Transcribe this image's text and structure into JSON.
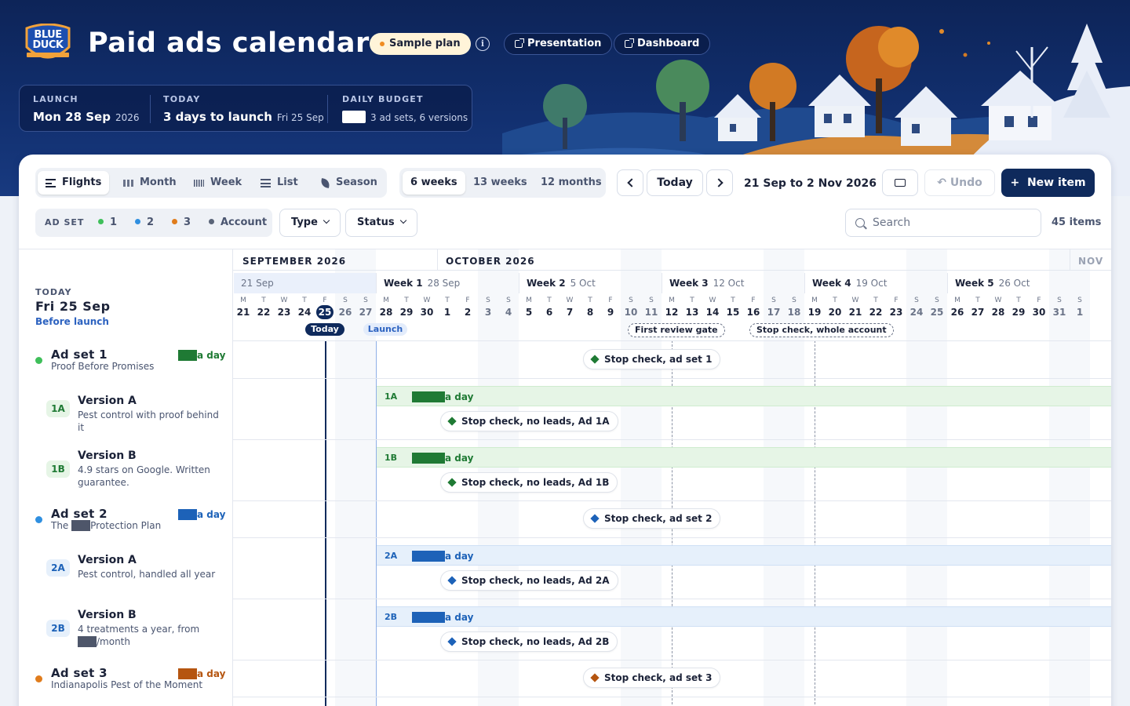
{
  "header": {
    "logo_text": "BLUE DUCK",
    "title": "Paid ads calendar",
    "sample_badge": "Sample plan",
    "info_icon": "info-icon",
    "presentation_label": "Presentation",
    "dashboard_label": "Dashboard"
  },
  "stats": {
    "launch_label": "LAUNCH",
    "launch_value": "Mon 28 Sep",
    "launch_year": "2026",
    "today_label": "TODAY",
    "today_value": "3 days to launch",
    "today_sub": "Fri 25 Sep",
    "budget_label": "DAILY BUDGET",
    "budget_sub": "3 ad sets, 6 versions"
  },
  "toolbar": {
    "views": [
      "Flights",
      "Month",
      "Week",
      "List",
      "Season"
    ],
    "active_view": "Flights",
    "ranges": [
      "6 weeks",
      "13 weeks",
      "12 months"
    ],
    "active_range": "6 weeks",
    "today_button": "Today",
    "date_range": "21 Sep to 2 Nov 2026",
    "undo_label": "Undo",
    "new_item_label": "New item"
  },
  "filters": {
    "adset_label": "AD SET",
    "set1": "1",
    "set2": "2",
    "set3": "3",
    "account": "Account",
    "type_label": "Type",
    "status_label": "Status",
    "search_placeholder": "Search",
    "item_count": "45 items"
  },
  "colors": {
    "set1": "#3fbf5a",
    "set2": "#2f8fe0",
    "set3": "#e07c1c",
    "account": "#5a6478",
    "set1_bar": "#e6f5e6",
    "set2_bar": "#e6f0fb",
    "set1_budget": "#1f7a34",
    "set2_budget": "#1d62b8",
    "set3_budget": "#b55510"
  },
  "calendar": {
    "months": [
      "SEPTEMBER 2026",
      "OCTOBER 2026",
      "NOV"
    ],
    "first_week": "21 Sep",
    "weeks": [
      {
        "name": "Week 1",
        "date": "28 Sep"
      },
      {
        "name": "Week 2",
        "date": "5 Oct"
      },
      {
        "name": "Week 3",
        "date": "12 Oct"
      },
      {
        "name": "Week 4",
        "date": "19 Oct"
      },
      {
        "name": "Week 5",
        "date": "26 Oct"
      }
    ],
    "day_letters": [
      "M",
      "T",
      "W",
      "T",
      "F",
      "S",
      "S"
    ],
    "days": [
      "21",
      "22",
      "23",
      "24",
      "25",
      "26",
      "27",
      "28",
      "29",
      "30",
      "1",
      "2",
      "3",
      "4",
      "5",
      "6",
      "7",
      "8",
      "9",
      "10",
      "11",
      "12",
      "13",
      "14",
      "15",
      "16",
      "17",
      "18",
      "19",
      "20",
      "21",
      "22",
      "23",
      "24",
      "25",
      "26",
      "27",
      "28",
      "29",
      "30",
      "31",
      "1"
    ],
    "today_tag": "Today",
    "launch_tag": "Launch",
    "gate1": "First review gate",
    "gate2": "Stop check, whole account"
  },
  "today_panel": {
    "label": "TODAY",
    "date": "Fri 25 Sep",
    "status": "Before launch"
  },
  "budget_suffix": "a day",
  "adsets": [
    {
      "name": "Ad set 1",
      "desc": "Proof Before Promises",
      "milestone": "Stop check, ad set 1"
    },
    {
      "name": "Ad set 2",
      "desc_pre": "The",
      "desc_post": "Protection Plan",
      "milestone": "Stop check, ad set 2"
    },
    {
      "name": "Ad set 3",
      "desc": "Indianapolis Pest of the Moment",
      "milestone": "Stop check, ad set 3"
    }
  ],
  "versions": [
    {
      "badge": "1A",
      "name": "Version A",
      "desc": "Pest control with proof behind it",
      "milestone": "Stop check, no leads, Ad 1A"
    },
    {
      "badge": "1B",
      "name": "Version B",
      "desc": "4.9 stars on Google. Written guarantee.",
      "milestone": "Stop check, no leads, Ad 1B"
    },
    {
      "badge": "2A",
      "name": "Version A",
      "desc": "Pest control, handled all year",
      "milestone": "Stop check, no leads, Ad 2A"
    },
    {
      "badge": "2B",
      "name": "Version B",
      "desc": "4 treatments a year, from",
      "desc_post": "/month",
      "milestone": "Stop check, no leads, Ad 2B"
    }
  ]
}
